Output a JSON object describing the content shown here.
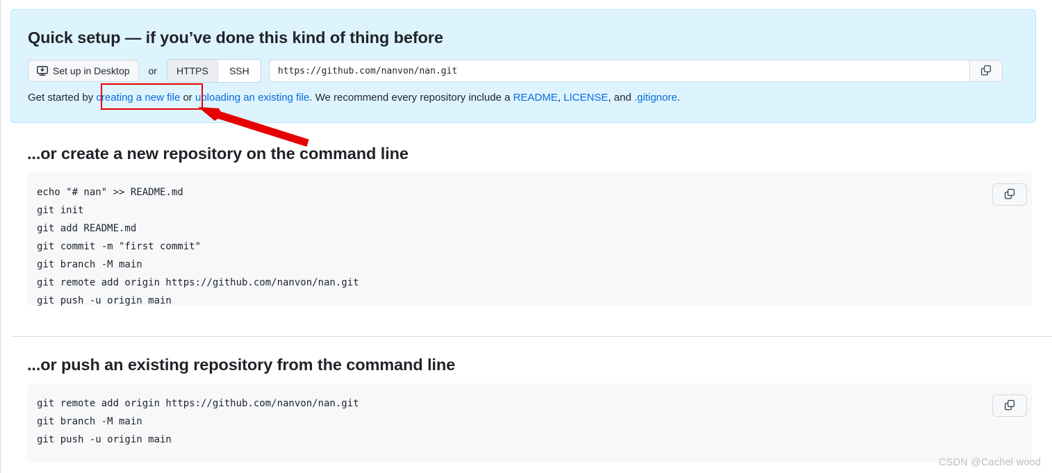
{
  "quick_setup": {
    "title": "Quick setup — if you’ve done this kind of thing before",
    "desktop_button_label": "Set up in Desktop",
    "desktop_button_icon": "desktop-download-icon",
    "or_label": "or",
    "protocols": [
      {
        "label": "HTTPS",
        "selected": true
      },
      {
        "label": "SSH",
        "selected": false
      }
    ],
    "clone_url": "https://github.com/nanvon/nan.git",
    "clone_url_placeholder": "https://github.com/nanvon/nan.git",
    "copy_icon": "copy-icon",
    "help": {
      "prefix": "Get started by ",
      "link_create": "creating a new file",
      "mid1": " or ",
      "link_upload": "uploading an existing file",
      "mid2": ". We recommend every repository include a ",
      "link_readme": "README",
      "sep1": ", ",
      "link_license": "LICENSE",
      "sep2": ", and ",
      "link_gitignore": ".gitignore",
      "suffix": "."
    }
  },
  "sections": [
    {
      "heading": "...or create a new repository on the command line",
      "copy_icon": "copy-icon",
      "code": "echo \"# nan\" >> README.md\ngit init\ngit add README.md\ngit commit -m \"first commit\"\ngit branch -M main\ngit remote add origin https://github.com/nanvon/nan.git\ngit push -u origin main"
    },
    {
      "heading": "...or push an existing repository from the command line",
      "copy_icon": "copy-icon",
      "code": "git remote add origin https://github.com/nanvon/nan.git\ngit branch -M main\ngit push -u origin main"
    }
  ],
  "annotation": {
    "highlight_target": "creating a new file",
    "color": "#e60000",
    "arrow_icon": "arrow-pointing-up-left-icon"
  },
  "watermark": "CSDN @Cachel wood",
  "colors": {
    "panel_background": "#ddf4ff",
    "panel_border": "#b6e3ff",
    "link": "#0969da",
    "code_background": "#f6f8fa",
    "annotation_red": "#e60000"
  }
}
